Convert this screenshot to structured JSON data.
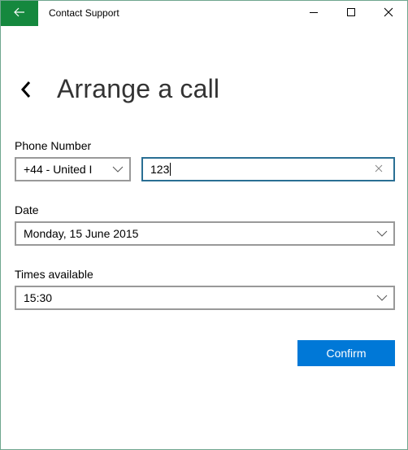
{
  "window": {
    "title": "Contact Support",
    "accent_color": "#15883e",
    "controls": [
      "minimize",
      "maximize",
      "close"
    ]
  },
  "page": {
    "title": "Arrange a call"
  },
  "form": {
    "phone": {
      "label": "Phone Number",
      "country_code_selected": "+44 - United I",
      "number_value": "123"
    },
    "date": {
      "label": "Date",
      "selected": "Monday, 15 June 2015"
    },
    "time": {
      "label": "Times available",
      "selected": "15:30"
    },
    "confirm_label": "Confirm",
    "confirm_color": "#0078d7"
  }
}
